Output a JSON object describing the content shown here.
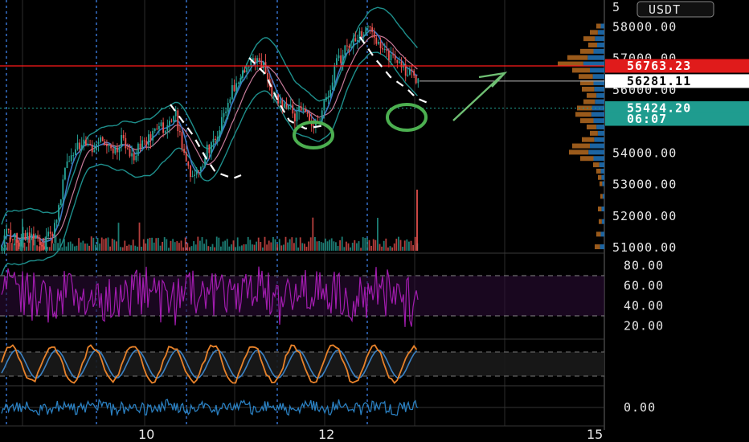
{
  "currency_badge": "USDT",
  "colors": {
    "up": "#26a69a",
    "down": "#ef5350",
    "bollinger": "#1e8f8c",
    "ma_blue": "#3b78c4",
    "ma_pink": "#c77b9a",
    "last_price_line": "#ff1a1a",
    "rsi": "#a21caf",
    "stoch_k": "#e8822a",
    "stoch_d": "#3b82c4",
    "macd": "#2a7fc0",
    "marker_green": "#4caf50",
    "session_line": "#3a78d8"
  },
  "chart_data": [
    {
      "type": "candlestick",
      "pane": "price",
      "y_ticks": [
        "58000.00",
        "57000.00",
        "56000.00",
        "54000.00",
        "53000.00",
        "52000.00",
        "51000.00"
      ],
      "ylim": [
        50900,
        58700
      ],
      "price_tags": [
        {
          "label": "56763.23",
          "value": 56763.23,
          "style": "red"
        },
        {
          "label": "56281.11",
          "value": 56281.11,
          "style": "white"
        },
        {
          "label": "55424.20",
          "value": 55424.2,
          "style": "teal"
        },
        {
          "label": "06:07",
          "value": 55080,
          "style": "teal"
        }
      ],
      "close_path": [
        [
          0,
          51000
        ],
        [
          0.01,
          51500
        ],
        [
          0.03,
          51200
        ],
        [
          0.05,
          51400
        ],
        [
          0.08,
          51100
        ],
        [
          0.1,
          51600
        ],
        [
          0.11,
          52500
        ],
        [
          0.12,
          53400
        ],
        [
          0.13,
          53900
        ],
        [
          0.15,
          54300
        ],
        [
          0.17,
          54100
        ],
        [
          0.19,
          54500
        ],
        [
          0.21,
          54000
        ],
        [
          0.23,
          54400
        ],
        [
          0.25,
          53900
        ],
        [
          0.27,
          54300
        ],
        [
          0.29,
          54600
        ],
        [
          0.3,
          55000
        ],
        [
          0.31,
          54800
        ],
        [
          0.33,
          55300
        ],
        [
          0.34,
          54600
        ],
        [
          0.35,
          53800
        ],
        [
          0.36,
          53400
        ],
        [
          0.37,
          53200
        ],
        [
          0.38,
          53500
        ],
        [
          0.39,
          54000
        ],
        [
          0.41,
          54600
        ],
        [
          0.43,
          55600
        ],
        [
          0.45,
          56300
        ],
        [
          0.47,
          56900
        ],
        [
          0.49,
          57000
        ],
        [
          0.5,
          56700
        ],
        [
          0.51,
          56200
        ],
        [
          0.52,
          55800
        ],
        [
          0.53,
          55700
        ],
        [
          0.55,
          55400
        ],
        [
          0.56,
          55100
        ],
        [
          0.57,
          55400
        ],
        [
          0.58,
          55200
        ],
        [
          0.59,
          55000
        ],
        [
          0.6,
          55000
        ],
        [
          0.61,
          55200
        ],
        [
          0.62,
          55700
        ],
        [
          0.63,
          56300
        ],
        [
          0.64,
          56800
        ],
        [
          0.65,
          57100
        ],
        [
          0.67,
          57500
        ],
        [
          0.69,
          57800
        ],
        [
          0.7,
          58100
        ],
        [
          0.71,
          57700
        ],
        [
          0.72,
          57400
        ],
        [
          0.73,
          57200
        ],
        [
          0.75,
          57000
        ],
        [
          0.76,
          56800
        ],
        [
          0.77,
          56600
        ],
        [
          0.78,
          56500
        ],
        [
          0.79,
          56300
        ],
        [
          0.8,
          56100
        ]
      ],
      "volume_profile_levels": [
        [
          58000,
          10
        ],
        [
          57800,
          18
        ],
        [
          57600,
          26
        ],
        [
          57400,
          20
        ],
        [
          57200,
          30
        ],
        [
          57000,
          46
        ],
        [
          56800,
          58
        ],
        [
          56600,
          40
        ],
        [
          56400,
          32
        ],
        [
          56200,
          30
        ],
        [
          56000,
          28
        ],
        [
          55800,
          22
        ],
        [
          55600,
          26
        ],
        [
          55400,
          34
        ],
        [
          55200,
          36
        ],
        [
          55000,
          30
        ],
        [
          54800,
          22
        ],
        [
          54600,
          18
        ],
        [
          54400,
          28
        ],
        [
          54200,
          40
        ],
        [
          54000,
          44
        ],
        [
          53800,
          30
        ],
        [
          53600,
          14
        ],
        [
          53400,
          10
        ],
        [
          53200,
          8
        ],
        [
          53000,
          6
        ],
        [
          52600,
          5
        ],
        [
          52200,
          8
        ],
        [
          51800,
          7
        ],
        [
          51400,
          10
        ],
        [
          51000,
          12
        ]
      ]
    },
    {
      "type": "line",
      "pane": "rsi",
      "name": "",
      "y_ticks": [
        "80.00",
        "60.00",
        "40.00",
        "20.00"
      ],
      "ylim": [
        10,
        90
      ],
      "levels": [
        70,
        30
      ]
    },
    {
      "type": "line",
      "pane": "stochastic",
      "ylim": [
        0,
        100
      ]
    },
    {
      "type": "line",
      "pane": "macd",
      "y_ticks": [
        "0.00"
      ]
    }
  ],
  "x_labels": [
    "10",
    "12",
    "15"
  ]
}
